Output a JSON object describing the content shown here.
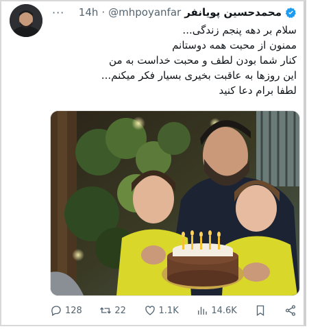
{
  "tweet": {
    "display_name": "محمدحسین پویانفر",
    "handle": "@mhpoyanfar",
    "separator": "·",
    "time": "14h",
    "lines": [
      "سلام بر دهه پنجم زندگی...",
      "ممنون از محبت همه دوستانم",
      "کنار شما بودن لطف و محبت خداست به من",
      "این روزها به عاقبت بخیری بسیار فکر میکنم...",
      "لطفا برام دعا کنید"
    ]
  },
  "actions": {
    "replies": "128",
    "retweets": "22",
    "likes": "1.1K",
    "views": "14.6K"
  },
  "colors": {
    "accent": "#1d9bf0",
    "muted": "#536471",
    "cake_candle": "#f2c230",
    "shirt_yellow": "#d9d82a"
  },
  "icons": [
    "verified-badge-icon",
    "more-icon",
    "reply-icon",
    "retweet-icon",
    "like-icon",
    "views-icon",
    "bookmark-icon",
    "share-icon"
  ]
}
